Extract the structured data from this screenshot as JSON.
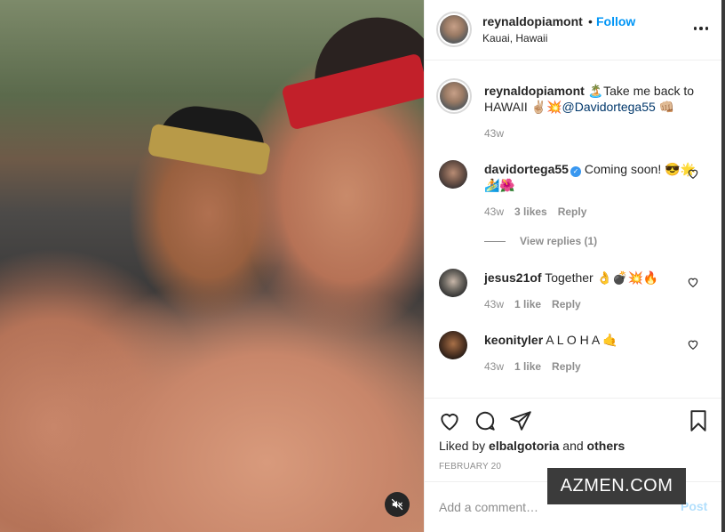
{
  "post": {
    "username": "reynaldopiamont",
    "follow_label": "Follow",
    "location": "Kauai, Hawaii",
    "caption_user": "reynaldopiamont",
    "caption_text": "🏝️Take me back to HAWAII ✌🏼💥",
    "caption_mention": "@Davidortega55",
    "caption_tail": " 👊🏼",
    "caption_age": "43w"
  },
  "comments": [
    {
      "user": "davidortega55",
      "verified": true,
      "text": "Coming soon! 😎🌟🏄🌺",
      "age": "43w",
      "likes": "3 likes",
      "reply": "Reply",
      "view_replies": "View replies (1)"
    },
    {
      "user": "jesus21of",
      "verified": false,
      "text": "Together 👌💣💥🔥",
      "age": "43w",
      "likes": "1 like",
      "reply": "Reply"
    },
    {
      "user": "keonityler",
      "verified": false,
      "text": "A L O H A 🤙",
      "age": "43w",
      "likes": "1 like",
      "reply": "Reply"
    }
  ],
  "actions": {
    "liked_prefix": "Liked by ",
    "liked_user": "elbalgotoria",
    "liked_and": " and ",
    "liked_others": "others",
    "date": "FEBRUARY 20"
  },
  "add_comment": {
    "placeholder": "Add a comment…",
    "post_label": "Post"
  },
  "watermark": "AZMEN.COM",
  "icons": [
    "mute-icon",
    "more-icon",
    "heart-icon",
    "comment-icon",
    "share-icon",
    "bookmark-icon",
    "verified-icon"
  ],
  "colors": {
    "follow": "#0095f6",
    "mention": "#00376b",
    "muted_text": "#8e8e8e",
    "post_disabled": "#b2dffc"
  }
}
